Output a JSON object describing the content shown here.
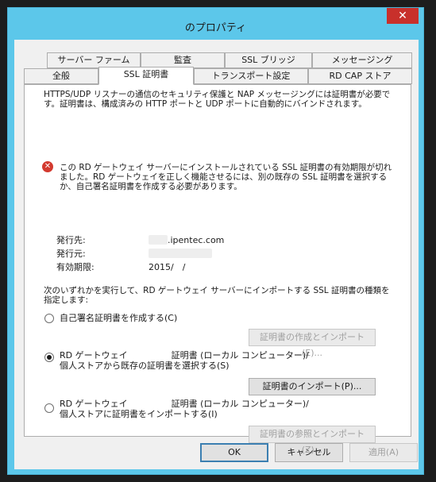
{
  "window": {
    "title": "のプロパティ",
    "close_glyph": "✕"
  },
  "tabs": {
    "row1": [
      "サーバー ファーム",
      "監査",
      "SSL ブリッジ",
      "メッセージング"
    ],
    "row2": [
      "全般",
      "SSL 証明書",
      "トランスポート設定",
      "RD CAP ストア"
    ],
    "active": "SSL 証明書"
  },
  "panel": {
    "intro": "HTTPS/UDP リスナーの通信のセキュリティ保護と NAP メッセージングには証明書が必要で\nす。証明書は、構成済みの HTTP ポートと UDP ポートに自動的にバインドされます。",
    "error_text": "この RD ゲートウェイ サーバーにインストールされている SSL 証明書の有効期限が切れ\nました。RD ゲートウェイを正しく機能させるには、別の既存の SSL 証明書を選択する\nか、自己署名証明書を作成する必要があります。",
    "cert": {
      "issued_to_label": "発行先:",
      "issued_to_value": ".ipentec.com",
      "issued_by_label": "発行元:",
      "issued_by_value": "",
      "expiry_label": "有効期限:",
      "expiry_value": "2015/　/"
    },
    "choose_prompt": "次のいずれかを実行して、RD ゲートウェイ サーバーにインポートする SSL 証明書の種類を\n指定します:",
    "options": [
      {
        "label": "自己署名証明書を作成する(C)",
        "checked": false,
        "button": "証明書の作成とインポート(E)...",
        "button_enabled": false
      },
      {
        "label_line1": "RD ゲートウェイ　　　　　証明書 (ローカル コンピューター)/",
        "label_line2": "個人ストアから既存の証明書を選択する(S)",
        "checked": true,
        "button": "証明書のインポート(P)...",
        "button_enabled": true
      },
      {
        "label_line1": "RD ゲートウェイ　　　　　証明書 (ローカル コンピューター)/",
        "label_line2": "個人ストアに証明書をインポートする(I)",
        "checked": false,
        "button": "証明書の参照とインポート(Z)...",
        "button_enabled": false
      }
    ]
  },
  "footer": {
    "ok": "OK",
    "cancel": "キャンセル",
    "apply": "適用(A)"
  },
  "colors": {
    "frame": "#5cc7ea",
    "close": "#c8302b",
    "error": "#d33a2f"
  }
}
